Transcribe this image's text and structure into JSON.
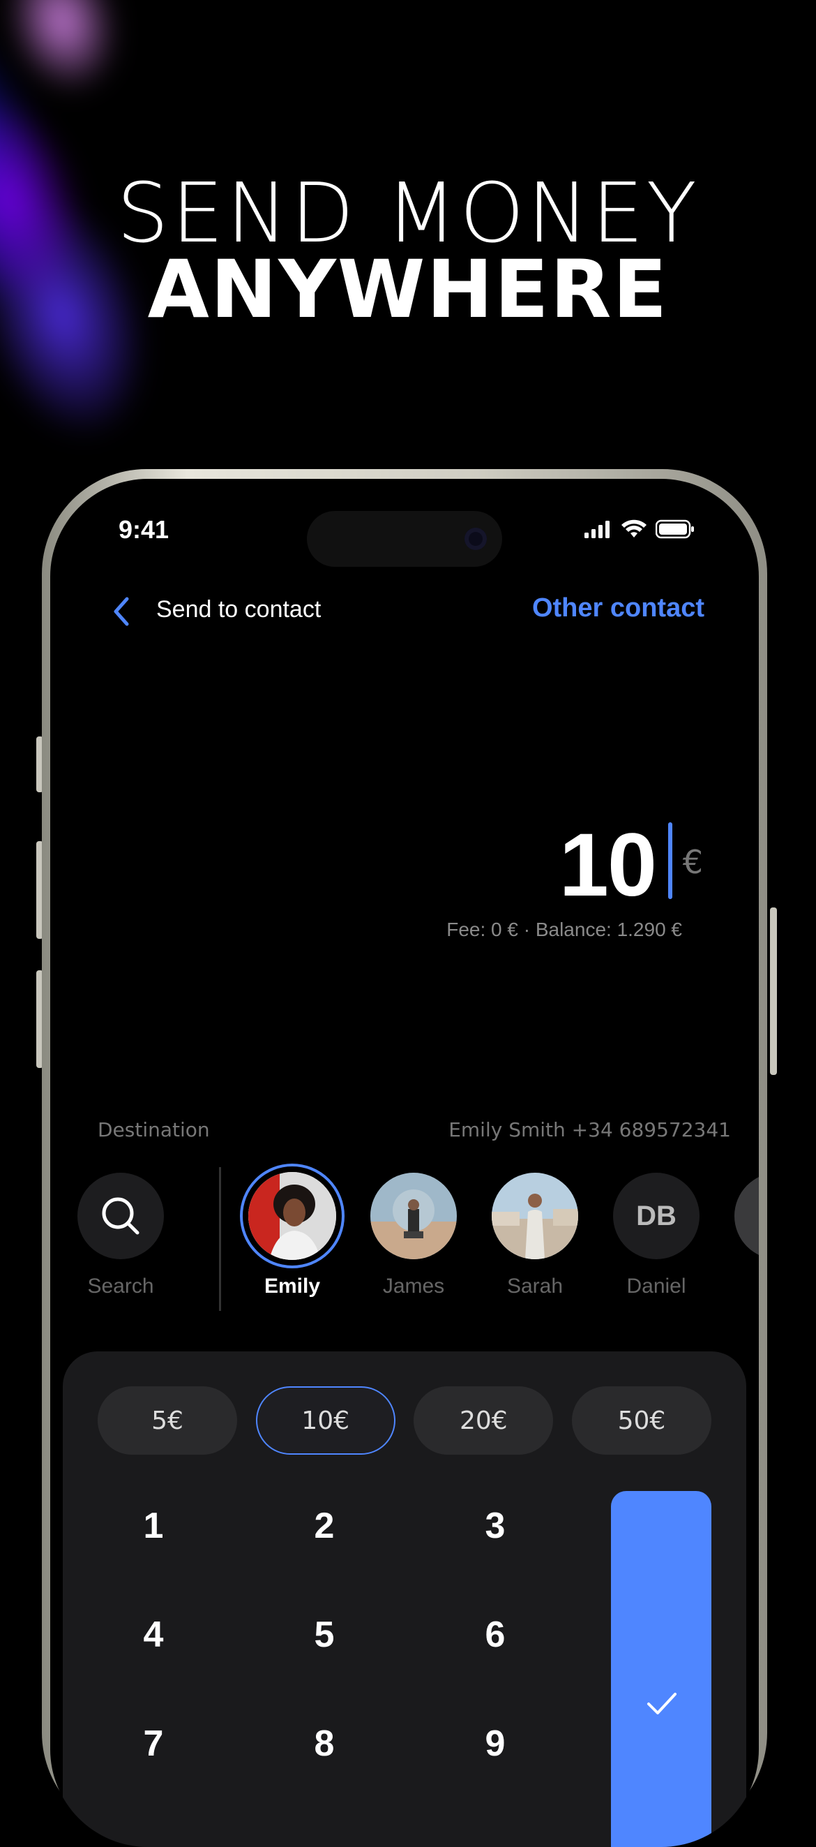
{
  "hero": {
    "line1": "SEND MONEY",
    "line2": "ANYWHERE"
  },
  "status_bar": {
    "time": "9:41"
  },
  "nav": {
    "title": "Send to contact",
    "action": "Other contact"
  },
  "amount": {
    "value": "10",
    "currency": "€",
    "fee_text": "Fee:  0 € · Balance: 1.290 €"
  },
  "destination": {
    "label": "Destination",
    "value": "Emily Smith   +34 689572341"
  },
  "contacts": [
    {
      "name": "Search",
      "type": "search"
    },
    {
      "name": "Emily",
      "type": "photo",
      "selected": true
    },
    {
      "name": "James",
      "type": "photo"
    },
    {
      "name": "Sarah",
      "type": "photo"
    },
    {
      "name": "Daniel",
      "type": "initials",
      "initials": "DB"
    }
  ],
  "quick_amounts": [
    "5€",
    "10€",
    "20€",
    "50€"
  ],
  "selected_quick_amount": "10€",
  "keypad": [
    "1",
    "2",
    "3",
    "4",
    "5",
    "6",
    "7",
    "8",
    "9"
  ],
  "colors": {
    "accent": "#4f86ff",
    "background": "#000000",
    "panel": "#1a1a1c"
  },
  "icons": {
    "back": "chevron-left-icon",
    "search": "search-icon",
    "confirm": "checkmark-icon"
  }
}
